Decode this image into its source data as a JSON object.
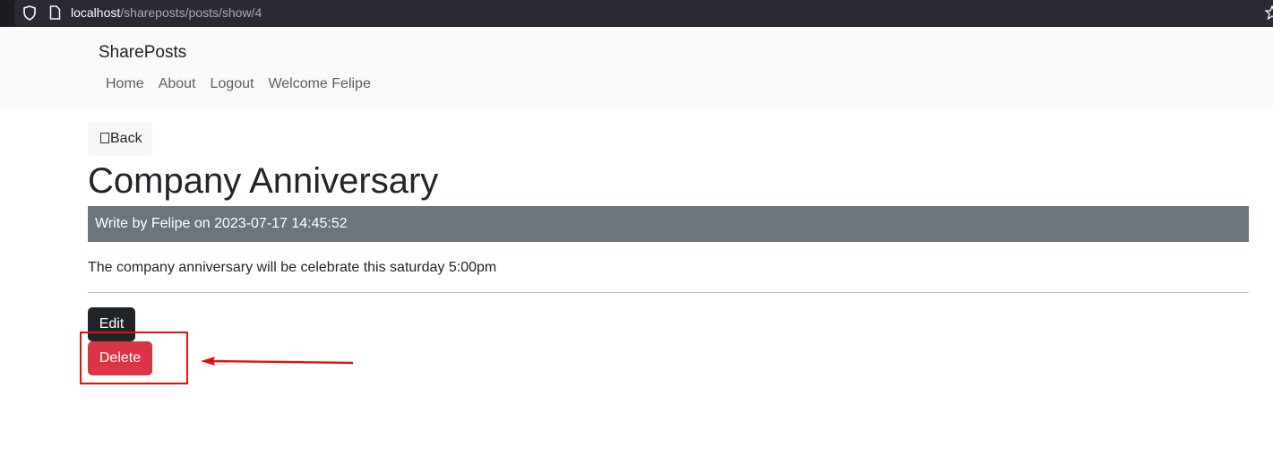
{
  "browser": {
    "url_host": "localhost",
    "url_path": "/shareposts/posts/show/4"
  },
  "navbar": {
    "brand": "SharePosts",
    "links": [
      {
        "label": "Home"
      },
      {
        "label": "About"
      },
      {
        "label": "Logout"
      },
      {
        "label": "Welcome Felipe"
      }
    ]
  },
  "post": {
    "back_label": "Back",
    "title": "Company Anniversary",
    "meta": "Write by Felipe on 2023-07-17 14:45:52",
    "body": "The company anniversary will be celebrate this saturday 5:00pm",
    "edit_label": "Edit",
    "delete_label": "Delete"
  },
  "colors": {
    "navbar_bg": "#f8f9fa",
    "meta_bg": "#6c757d",
    "edit_bg": "#212529",
    "delete_bg": "#dc3545",
    "annotation": "#e01010"
  },
  "icons": {
    "address_bar": [
      "shield-icon",
      "page-icon",
      "star-icon"
    ],
    "back_button": "missing-glyph-icon",
    "annotation": "arrow-left-icon"
  }
}
